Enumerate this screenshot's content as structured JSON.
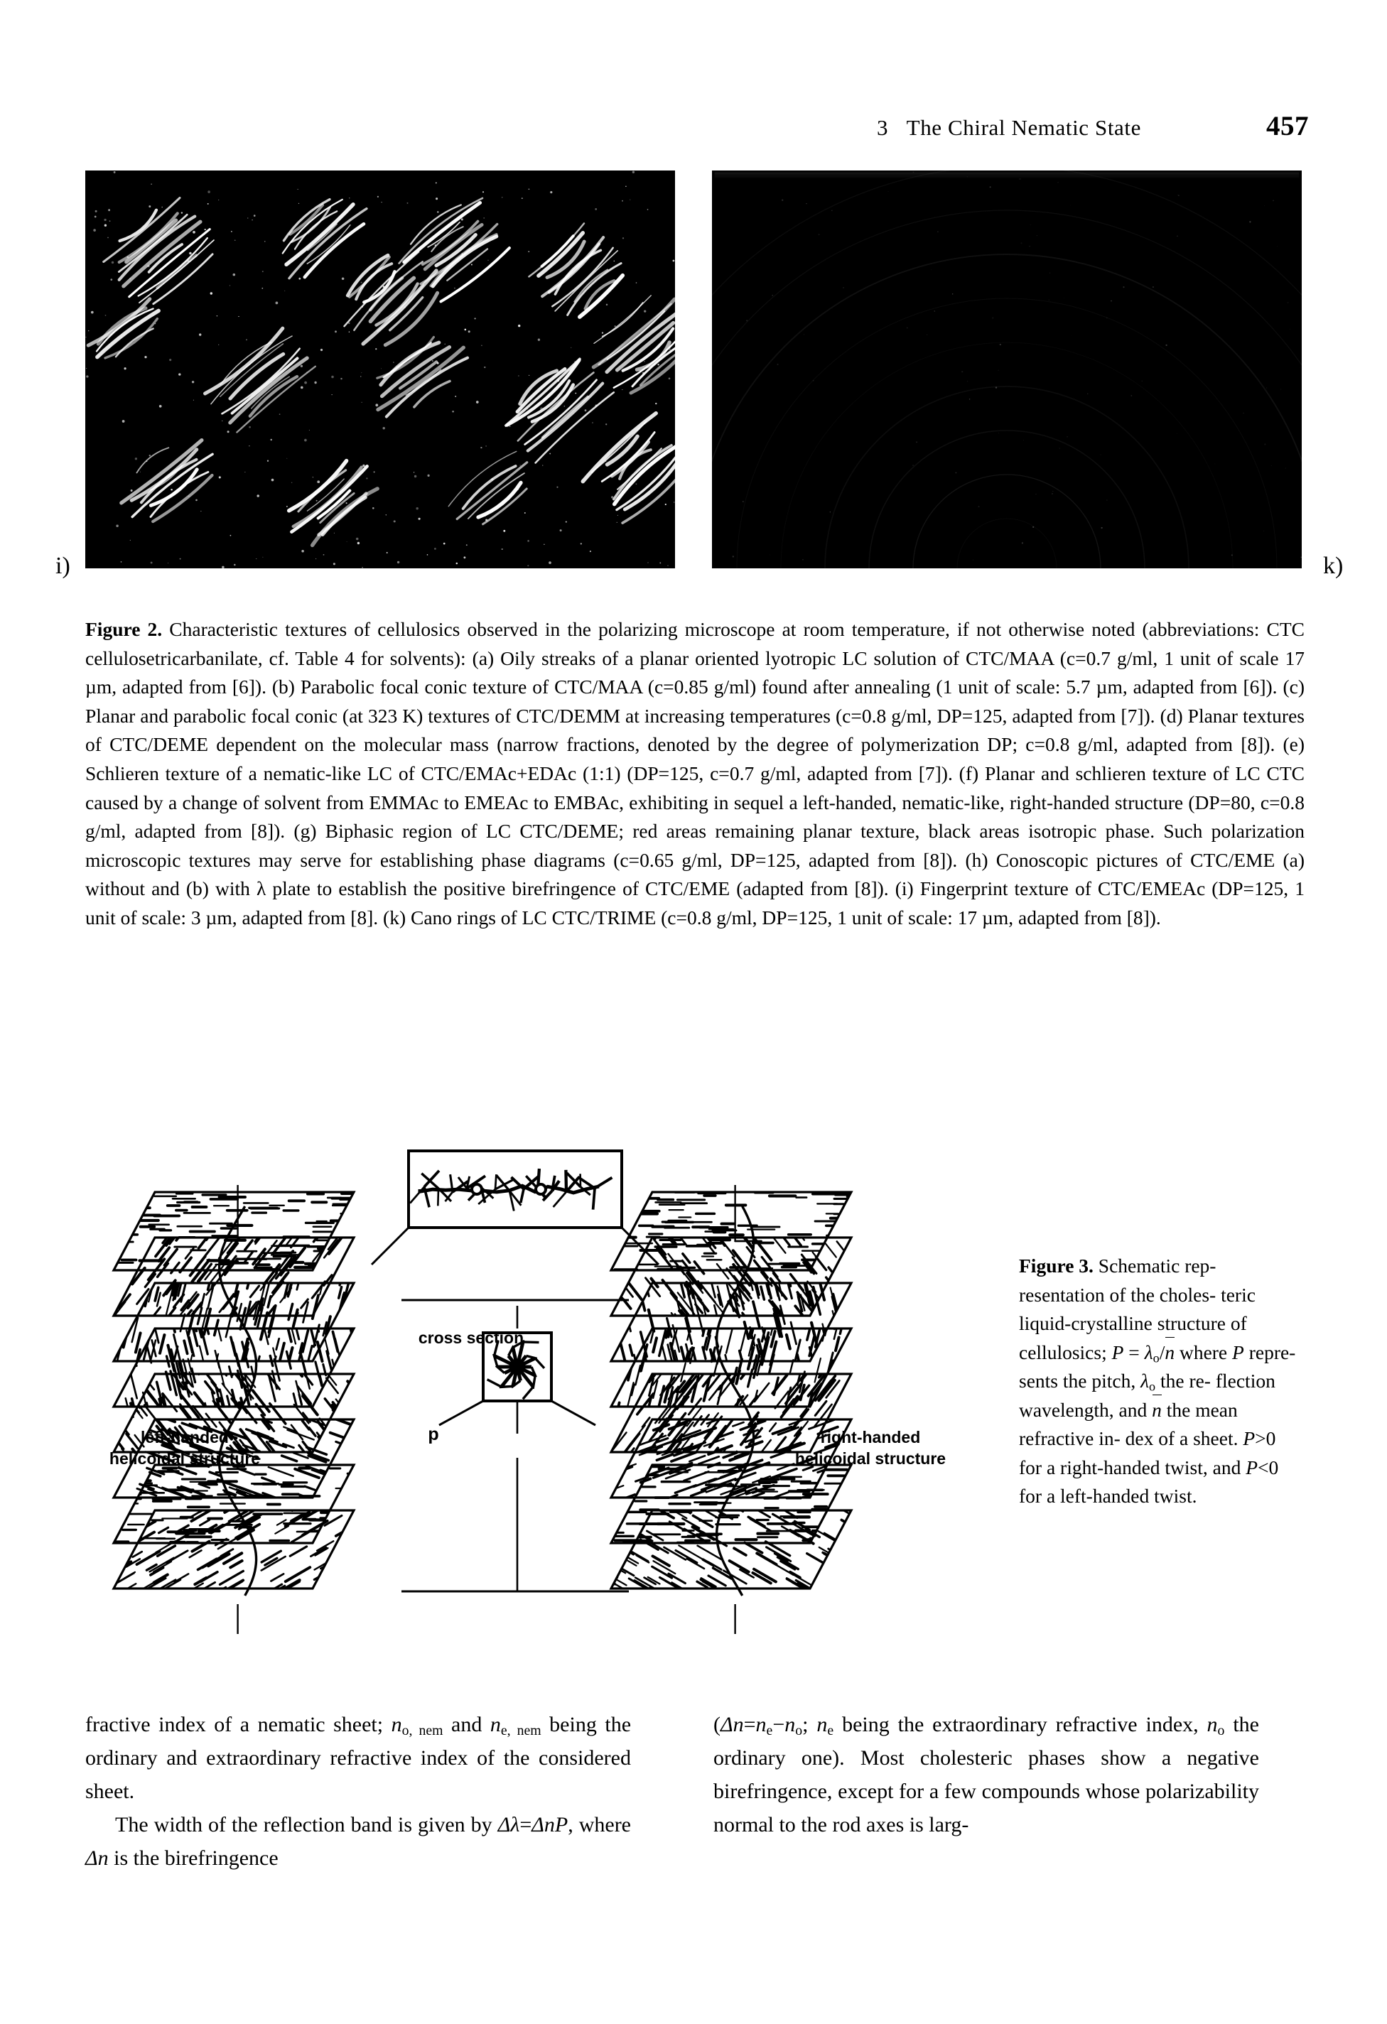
{
  "running_head": {
    "chapter_number": "3",
    "chapter_title": "The Chiral Nematic State",
    "page_number": "457"
  },
  "plates": {
    "left": {
      "tag": "i)",
      "description": "Fingerprint texture of CTC/EMEAc micrograph"
    },
    "right": {
      "tag": "k)",
      "description": "Cano rings of LC CTC/TRIME micrograph"
    }
  },
  "figure2": {
    "label": "Figure 2.",
    "text": " Characteristic textures of cellulosics observed in the polarizing microscope at room temperature, if not otherwise noted (abbreviations: CTC cellulosetricarbanilate, cf. Table 4 for solvents): (a) Oily streaks of a planar oriented lyotropic LC solution of CTC/MAA (c=0.7 g/ml, 1 unit of scale 17 µm, adapted from [6]). (b) Parabolic focal conic texture of CTC/MAA (c=0.85 g/ml) found after annealing (1 unit of scale: 5.7 µm, adapted from [6]). (c) Planar and parabolic focal conic (at 323 K) textures of CTC/DEMM at increasing temperatures (c=0.8 g/ml, DP=125, adapted from [7]). (d) Planar textures of CTC/DEME dependent on the molecular mass (narrow fractions, denoted by the degree of polymerization DP; c=0.8 g/ml, adapted from [8]). (e) Schlieren texture of a nematic-like LC of CTC/EMAc+EDAc (1:1) (DP=125, c=0.7 g/ml, adapted from [7]). (f) Planar and schlieren texture of LC CTC caused by a change of solvent from EMMAc to EMEAc to EMBAc, exhibiting in sequel a left-handed, nematic-like, right-handed structure (DP=80, c=0.8 g/ml, adapted from [8]). (g) Biphasic region of LC CTC/DEME; red areas remaining planar texture, black areas isotropic phase. Such polarization microscopic textures may serve for establishing phase diagrams (c=0.65 g/ml, DP=125, adapted from [8]). (h) Conoscopic pictures of CTC/EME (a) without and (b) with λ plate to establish the positive birefringence of CTC/EME (adapted from [8]). (i) Fingerprint texture of CTC/EMEAc (DP=125, 1 unit of scale: 3 µm, adapted from [8]. (k) Cano rings of LC CTC/TRIME (c=0.8 g/ml, DP=125, 1 unit of scale: 17 µm, adapted from [8])."
  },
  "figure3_diagram": {
    "label_left": "left-handed",
    "label_left2": "helicoidal structure",
    "label_right": "right-handed",
    "label_right2": "helicoidal structure",
    "label_cross_section": "cross section",
    "label_pitch": "p"
  },
  "figure3_caption": {
    "label": "Figure 3.",
    "line1": " Schematic rep-",
    "line2": "resentation of the choles-",
    "line3": "teric liquid-crystalline",
    "line4": "structure of cellulosics;",
    "formula_P": "P",
    "formula_eq": " = ",
    "formula_lambda": "λ",
    "formula_lambda_sub": "o",
    "formula_slash": "/",
    "formula_nbar": "n",
    "line5_rest": " where ",
    "formula_P2": "P",
    "line5_end": " repre-",
    "line6a": "sents the pitch, ",
    "formula_lambda2": "λ",
    "formula_lambda2_sub": "o",
    "line6b": " the re-",
    "line7": "flection wavelength, and",
    "line8a": "n",
    "line8b": " the mean refractive in-",
    "line9a": "dex of a sheet. ",
    "line9P": "P",
    "line9b": ">0 for",
    "line10": "a right-handed twist, and",
    "line11P": "P",
    "line11b": "<0 for a left-handed",
    "line12": "twist."
  },
  "body_left": {
    "p1_a": "fractive index of a nematic sheet; ",
    "p1_n": "n",
    "p1_sub": "o, nem",
    "p1_b": " and ",
    "p1_n2": "n",
    "p1_sub2": "e, nem",
    "p1_c": " being the ordinary and extraordinary refractive index of the considered sheet.",
    "p2_a": "The width of the reflection band is given by ",
    "p2_formula_a": "Δλ",
    "p2_formula_eq": "=",
    "p2_formula_b": "Δn",
    "p2_formula_P": "P",
    "p2_b": ", where ",
    "p2_formula_c": "Δn",
    "p2_c": " is the birefringence"
  },
  "body_right": {
    "p1_open": "(",
    "p1_dn": "Δn",
    "p1_eq": "=",
    "p1_ne": "n",
    "p1_ne_sub": "e",
    "p1_minus": "−",
    "p1_no": "n",
    "p1_no_sub": "o",
    "p1_semi": "; ",
    "p1_ne2": "n",
    "p1_ne2_sub": "e",
    "p1_rest": " being the extraordinary refractive index, ",
    "p1_no2": "n",
    "p1_no2_sub": "o",
    "p1_tail": " the ordinary one). Most cholesteric phases show a negative birefringence, except for a few compounds whose polarizability normal to the rod axes is larg-"
  }
}
